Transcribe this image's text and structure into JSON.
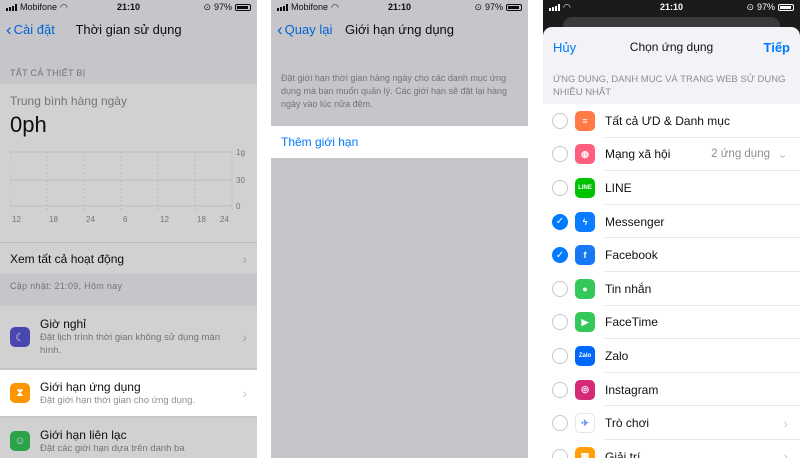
{
  "screen1": {
    "status": {
      "carrier": "Mobifone",
      "time": "21:10",
      "battery": "97%"
    },
    "back_label": "Cài đặt",
    "title": "Thời gian sử dụng",
    "section_all_devices": "TẤT CẢ THIẾT BỊ",
    "avg_label": "Trung bình hàng ngày",
    "avg_value": "0ph",
    "chart_ticks": [
      "12",
      "18",
      "24",
      "6",
      "12",
      "18",
      "24"
    ],
    "chart_ylabels": [
      "1g",
      "30",
      "0"
    ],
    "see_all": "Xem tất cả hoạt động",
    "updated": "Cập nhật: 21:09, Hôm nay",
    "items": [
      {
        "title": "Giờ nghỉ",
        "subtitle": "Đặt lịch trình thời gian không sử dụng màn hình.",
        "color": "#5856d6",
        "icon": "moon-icon"
      },
      {
        "title": "Giới hạn ứng dụng",
        "subtitle": "Đặt giới hạn thời gian cho ứng dụng.",
        "color": "#ff9500",
        "icon": "hourglass-icon"
      },
      {
        "title": "Giới hạn liên lạc",
        "subtitle": "Đặt các giới hạn dựa trên danh ba",
        "color": "#34c759",
        "icon": "contact-icon"
      }
    ]
  },
  "screen2": {
    "status": {
      "carrier": "Mobifone",
      "time": "21:10",
      "battery": "97%"
    },
    "back_label": "Quay lại",
    "title": "Giới hạn ứng dụng",
    "description": "Đặt giới hạn thời gian hàng ngày cho các danh mục ứng dụng mà bạn muốn quản lý. Các giới hạn sẽ đặt lại hàng ngày vào lúc nửa đêm.",
    "add_limit": "Thêm giới hạn"
  },
  "screen3": {
    "status": {
      "time": "21:10",
      "battery": "97%"
    },
    "cancel": "Hủy",
    "title": "Chọn ứng dụng",
    "next": "Tiếp",
    "section": "ỨNG DỤNG, DANH MỤC VÀ TRANG WEB SỬ DỤNG NHIỀU NHẤT",
    "apps": [
      {
        "name": "Tất cả ƯD & Danh mục",
        "checked": false,
        "color": "#ff7a45",
        "icon": "stack-icon",
        "count": "",
        "chevron": false
      },
      {
        "name": "Mạng xã hội",
        "checked": false,
        "color": "#ff5e7d",
        "icon": "chat-bubbles-icon",
        "count": "2 ứng dụng",
        "chevron": true,
        "chev_down": true
      },
      {
        "name": "LINE",
        "checked": false,
        "color": "#00c300",
        "icon": "line-app-icon",
        "count": "",
        "chevron": false
      },
      {
        "name": "Messenger",
        "checked": true,
        "color": "#0a7cff",
        "icon": "messenger-icon",
        "count": "",
        "chevron": false
      },
      {
        "name": "Facebook",
        "checked": true,
        "color": "#1877f2",
        "icon": "facebook-icon",
        "count": "",
        "chevron": false
      },
      {
        "name": "Tin nhắn",
        "checked": false,
        "color": "#34c759",
        "icon": "messages-icon",
        "count": "",
        "chevron": false
      },
      {
        "name": "FaceTime",
        "checked": false,
        "color": "#34c759",
        "icon": "facetime-icon",
        "count": "",
        "chevron": false
      },
      {
        "name": "Zalo",
        "checked": false,
        "color": "#0068ff",
        "icon": "zalo-icon",
        "count": "",
        "chevron": false
      },
      {
        "name": "Instagram",
        "checked": false,
        "color": "#d62976",
        "icon": "instagram-icon",
        "count": "",
        "chevron": false
      },
      {
        "name": "Trò chơi",
        "checked": false,
        "color": "#ffffff",
        "icon": "rocket-icon",
        "count": "",
        "chevron": true
      },
      {
        "name": "Giải trí",
        "checked": false,
        "color": "#ff9f0a",
        "icon": "popcorn-icon",
        "count": "",
        "chevron": true
      }
    ]
  },
  "colors": {
    "accent": "#007aff",
    "check": "#007aff"
  }
}
